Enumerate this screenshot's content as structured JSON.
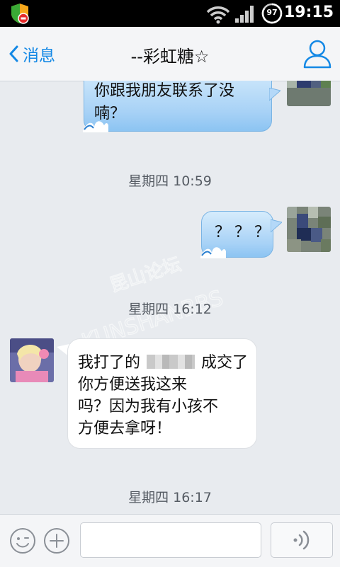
{
  "status_bar": {
    "time": "19:15",
    "battery_level": "97"
  },
  "nav": {
    "back_label": "消息",
    "title": "--彩虹糖☆"
  },
  "messages": [
    {
      "direction": "out",
      "lines": [
        "你跟我朋友联系了没",
        "喃？"
      ]
    },
    {
      "timestamp": "星期四 10:59"
    },
    {
      "direction": "out",
      "lines": [
        "？？？"
      ]
    },
    {
      "timestamp": "星期四 16:12"
    },
    {
      "direction": "in",
      "lines": [
        "我打了的",
        "成交了",
        "你方便送我这来",
        "吗？因为我有小孩不",
        "方便去拿呀！"
      ]
    },
    {
      "timestamp": "星期四 16:17"
    }
  ],
  "watermark": {
    "line1": "昆山论坛",
    "line2": "KUNSHANBBS"
  },
  "colors": {
    "accent": "#1388e5",
    "outgoing_bubble": "#a8d2f6",
    "incoming_bubble": "#ffffff"
  }
}
